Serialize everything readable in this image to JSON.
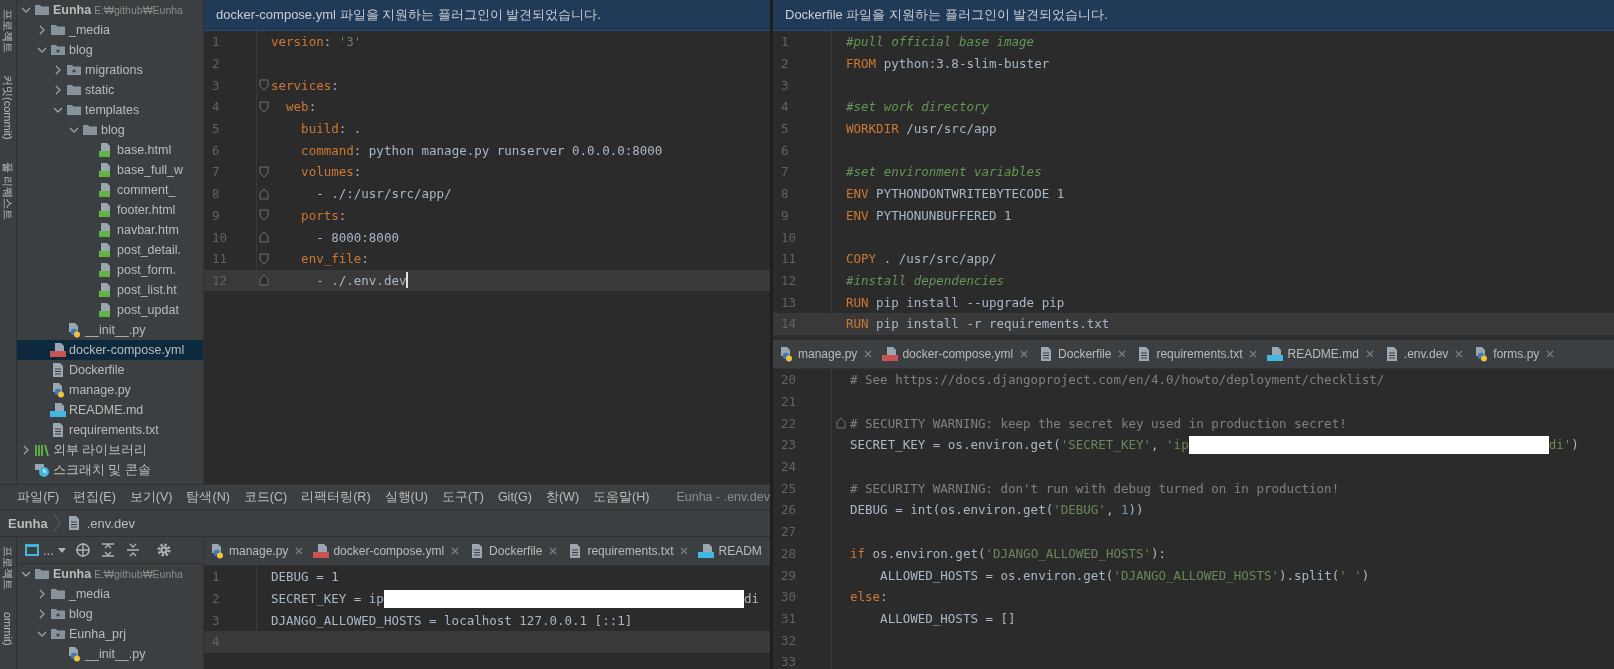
{
  "side_strip_top": {
    "labels": [
      "프로젝트",
      "커밋(commit)",
      "풀 리퀘스트"
    ]
  },
  "project_tree_top": {
    "items": [
      {
        "label": "Eunha",
        "path": "E:₩github₩Eunha",
        "kind": "folder",
        "expanded": true,
        "selected": false,
        "children": [
          {
            "label": "_media",
            "kind": "folder",
            "expanded": false,
            "selected": false
          },
          {
            "label": "blog",
            "kind": "package",
            "expanded": true,
            "selected": false,
            "children": [
              {
                "label": "migrations",
                "kind": "package",
                "expanded": false,
                "selected": false
              },
              {
                "label": "static",
                "kind": "folder",
                "expanded": false,
                "selected": false
              },
              {
                "label": "templates",
                "kind": "folder",
                "expanded": true,
                "selected": false,
                "children": [
                  {
                    "label": "blog",
                    "kind": "folder",
                    "expanded": true,
                    "selected": false,
                    "children": [
                      {
                        "label": "base.html",
                        "kind": "html",
                        "selected": false
                      },
                      {
                        "label": "base_full_w",
                        "kind": "html",
                        "selected": false
                      },
                      {
                        "label": "comment_",
                        "kind": "html",
                        "selected": false
                      },
                      {
                        "label": "footer.html",
                        "kind": "html",
                        "selected": false
                      },
                      {
                        "label": "navbar.htm",
                        "kind": "html",
                        "selected": false
                      },
                      {
                        "label": "post_detail.",
                        "kind": "html",
                        "selected": false
                      },
                      {
                        "label": "post_form.",
                        "kind": "html",
                        "selected": false
                      },
                      {
                        "label": "post_list.ht",
                        "kind": "html",
                        "selected": false
                      },
                      {
                        "label": "post_updat",
                        "kind": "html",
                        "selected": false
                      }
                    ]
                  }
                ]
              },
              {
                "label": "__init__.py",
                "kind": "python",
                "selected": false
              }
            ]
          },
          {
            "label": "docker-compose.yml",
            "kind": "yml",
            "selected": true
          },
          {
            "label": "Dockerfile",
            "kind": "file",
            "selected": false
          },
          {
            "label": "manage.py",
            "kind": "python",
            "selected": false
          },
          {
            "label": "README.md",
            "kind": "md",
            "selected": false
          },
          {
            "label": "requirements.txt",
            "kind": "file",
            "selected": false
          }
        ]
      },
      {
        "label": "외부 라이브러리",
        "kind": "library",
        "expanded": false,
        "selected": false
      },
      {
        "label": "스크래치 및 콘솔",
        "kind": "scratch",
        "selected": false
      }
    ]
  },
  "editor_top_left": {
    "notice": "docker-compose.yml 파일을 지원하는 플러그인이 발견되었습니다.",
    "lines": [
      {
        "num": "1",
        "current": false,
        "tokens": [
          {
            "kind": "key",
            "text": "version"
          },
          {
            "kind": "plain",
            "text": ": "
          },
          {
            "kind": "string",
            "text": "'3'"
          }
        ]
      },
      {
        "num": "2",
        "current": false
      },
      {
        "num": "3",
        "current": false,
        "kind": "fold-start",
        "tokens": [
          {
            "kind": "key",
            "text": "services"
          },
          {
            "kind": "plain",
            "text": ":"
          }
        ]
      },
      {
        "num": "4",
        "current": false,
        "kind": "fold-start",
        "tokens": [
          {
            "kind": "key",
            "text": "  web"
          },
          {
            "kind": "plain",
            "text": ":"
          }
        ]
      },
      {
        "num": "5",
        "current": false,
        "tokens": [
          {
            "kind": "key",
            "text": "    build"
          },
          {
            "kind": "plain",
            "text": ": ."
          }
        ]
      },
      {
        "num": "6",
        "current": false,
        "tokens": [
          {
            "kind": "key",
            "text": "    command"
          },
          {
            "kind": "plain",
            "text": ": python manage.py runserver 0.0.0.0:8000"
          }
        ]
      },
      {
        "num": "7",
        "current": false,
        "kind": "fold-start",
        "tokens": [
          {
            "kind": "key",
            "text": "    volumes"
          },
          {
            "kind": "plain",
            "text": ":"
          }
        ]
      },
      {
        "num": "8",
        "current": false,
        "kind": "fold-end",
        "tokens": [
          {
            "kind": "plain",
            "text": "      - ./:/usr/src/app/"
          }
        ]
      },
      {
        "num": "9",
        "current": false,
        "kind": "fold-start",
        "tokens": [
          {
            "kind": "key",
            "text": "    ports"
          },
          {
            "kind": "plain",
            "text": ":"
          }
        ]
      },
      {
        "num": "10",
        "current": false,
        "kind": "fold-end",
        "tokens": [
          {
            "kind": "plain",
            "text": "      - 8000:8000"
          }
        ]
      },
      {
        "num": "11",
        "current": false,
        "kind": "fold-start",
        "tokens": [
          {
            "kind": "key",
            "text": "    env_file"
          },
          {
            "kind": "plain",
            "text": ":"
          }
        ]
      },
      {
        "num": "12",
        "current": true,
        "kind": "fold-end",
        "tokens": [
          {
            "kind": "plain",
            "text": "      - ./.env.dev"
          }
        ]
      }
    ]
  },
  "menu_bar": {
    "items": [
      "파일(F)",
      "편집(E)",
      "보기(V)",
      "탐색(N)",
      "코드(C)",
      "리팩터링(R)",
      "실행(U)",
      "도구(T)",
      "Git(G)",
      "창(W)",
      "도움말(H)"
    ],
    "title": "Eunha - .env.dev"
  },
  "breadcrumb": {
    "project": "Eunha",
    "file": ".env.dev"
  },
  "side_strip_bottom": {
    "labels": [
      "프로젝트",
      "ommit)"
    ]
  },
  "tree_toolbar": {
    "view_label": "..."
  },
  "project_tree_bottom": {
    "items": [
      {
        "label": "Eunha",
        "path": "E:₩github₩Eunha",
        "kind": "folder",
        "expanded": true,
        "selected": false,
        "children": [
          {
            "label": "_media",
            "kind": "folder",
            "expanded": false,
            "selected": false
          },
          {
            "label": "blog",
            "kind": "package",
            "expanded": false,
            "selected": false
          },
          {
            "label": "Eunha_prj",
            "kind": "package",
            "expanded": true,
            "selected": false,
            "children": [
              {
                "label": "__init__.py",
                "kind": "python",
                "selected": false
              }
            ]
          }
        ]
      }
    ]
  },
  "editor_bottom_left": {
    "tabs": [
      {
        "label": "manage.py",
        "kind": "python",
        "selected": false,
        "closable": true
      },
      {
        "label": "docker-compose.yml",
        "kind": "yml",
        "selected": false,
        "closable": true
      },
      {
        "label": "Dockerfile",
        "kind": "file",
        "selected": false,
        "closable": true
      },
      {
        "label": "requirements.txt",
        "kind": "file",
        "selected": false,
        "closable": true
      },
      {
        "label": "READM",
        "kind": "md",
        "selected": false,
        "closable": false
      }
    ],
    "lines": [
      {
        "num": "1",
        "current": false,
        "tokens": [
          {
            "kind": "plain",
            "text": "DEBUG = 1"
          }
        ]
      },
      {
        "num": "2",
        "current": false,
        "tokens": [
          {
            "kind": "plain",
            "text": "SECRET_KEY = ip"
          },
          {
            "kind": "redacted"
          },
          {
            "kind": "plain",
            "text": "di"
          }
        ]
      },
      {
        "num": "3",
        "current": false,
        "tokens": [
          {
            "kind": "plain",
            "text": "DJANGO_ALLOWED_HOSTS = localhost 127.0.0.1 [::1]"
          }
        ]
      },
      {
        "num": "4",
        "current": true
      }
    ]
  },
  "editor_top_right": {
    "notice": "Dockerfile 파일을 지원하는 플러그인이 발견되었습니다.",
    "lines": [
      {
        "num": "1",
        "current": false,
        "tokens": [
          {
            "kind": "italic-comment",
            "text": "#pull official base image"
          }
        ]
      },
      {
        "num": "2",
        "current": false,
        "tokens": [
          {
            "kind": "keyword",
            "text": "FROM"
          },
          {
            "kind": "plain",
            "text": " python:3.8-slim-buster"
          }
        ]
      },
      {
        "num": "3",
        "current": false
      },
      {
        "num": "4",
        "current": false,
        "tokens": [
          {
            "kind": "italic-comment",
            "text": "#set work directory"
          }
        ]
      },
      {
        "num": "5",
        "current": false,
        "tokens": [
          {
            "kind": "keyword",
            "text": "WORKDIR"
          },
          {
            "kind": "plain",
            "text": " /usr/src/app"
          }
        ]
      },
      {
        "num": "6",
        "current": false
      },
      {
        "num": "7",
        "current": false,
        "tokens": [
          {
            "kind": "italic-comment",
            "text": "#set environment variables"
          }
        ]
      },
      {
        "num": "8",
        "current": false,
        "tokens": [
          {
            "kind": "keyword",
            "text": "ENV"
          },
          {
            "kind": "plain",
            "text": " PYTHONDONTWRITEBYTECODE 1"
          }
        ]
      },
      {
        "num": "9",
        "current": false,
        "tokens": [
          {
            "kind": "keyword",
            "text": "ENV"
          },
          {
            "kind": "plain",
            "text": " PYTHONUNBUFFERED 1"
          }
        ]
      },
      {
        "num": "10",
        "current": false
      },
      {
        "num": "11",
        "current": false,
        "tokens": [
          {
            "kind": "keyword",
            "text": "COPY"
          },
          {
            "kind": "plain",
            "text": " . /usr/src/app/"
          }
        ]
      },
      {
        "num": "12",
        "current": false,
        "tokens": [
          {
            "kind": "italic-comment",
            "text": "#install dependencies"
          }
        ]
      },
      {
        "num": "13",
        "current": false,
        "tokens": [
          {
            "kind": "keyword",
            "text": "RUN"
          },
          {
            "kind": "plain",
            "text": " pip install --upgrade pip"
          }
        ]
      },
      {
        "num": "14",
        "current": true,
        "tokens": [
          {
            "kind": "keyword",
            "text": "RUN"
          },
          {
            "kind": "plain",
            "text": " pip install -r requirements.txt"
          }
        ]
      }
    ]
  },
  "editor_bottom_right": {
    "tabs": [
      {
        "label": "manage.py",
        "kind": "python",
        "selected": false,
        "closable": true
      },
      {
        "label": "docker-compose.yml",
        "kind": "yml",
        "selected": false,
        "closable": true
      },
      {
        "label": "Dockerfile",
        "kind": "file",
        "selected": false,
        "closable": true
      },
      {
        "label": "requirements.txt",
        "kind": "file",
        "selected": false,
        "closable": true
      },
      {
        "label": "README.md",
        "kind": "md",
        "selected": false,
        "closable": true
      },
      {
        "label": ".env.dev",
        "kind": "file",
        "selected": false,
        "closable": true
      },
      {
        "label": "forms.py",
        "kind": "python",
        "selected": false,
        "closable": true
      }
    ],
    "lines": [
      {
        "num": "20",
        "current": false,
        "tokens": [
          {
            "kind": "comment",
            "text": "# See https://docs.djangoproject.com/en/4.0/howto/deployment/checklist/"
          }
        ]
      },
      {
        "num": "21",
        "current": false
      },
      {
        "num": "22",
        "current": false,
        "kind": "fold-end",
        "tokens": [
          {
            "kind": "comment",
            "text": "# SECURITY WARNING: keep the secret key used in production secret!"
          }
        ]
      },
      {
        "num": "23",
        "current": false,
        "tokens": [
          {
            "kind": "plain",
            "text": "SECRET_KEY = os.environ.get("
          },
          {
            "kind": "string",
            "text": "'SECRET_KEY'"
          },
          {
            "kind": "plain",
            "text": ", "
          },
          {
            "kind": "string",
            "text": "'ip"
          },
          {
            "kind": "redacted"
          },
          {
            "kind": "string",
            "text": "di'"
          },
          {
            "kind": "plain",
            "text": ")"
          }
        ]
      },
      {
        "num": "24",
        "current": false
      },
      {
        "num": "25",
        "current": false,
        "tokens": [
          {
            "kind": "comment",
            "text": "# SECURITY WARNING: don't run with debug turned on in production!"
          }
        ]
      },
      {
        "num": "26",
        "current": false,
        "tokens": [
          {
            "kind": "plain",
            "text": "DEBUG = int(os.environ.get("
          },
          {
            "kind": "string",
            "text": "'DEBUG'"
          },
          {
            "kind": "plain",
            "text": ", "
          },
          {
            "kind": "number",
            "text": "1"
          },
          {
            "kind": "plain",
            "text": "))"
          }
        ]
      },
      {
        "num": "27",
        "current": false
      },
      {
        "num": "28",
        "current": false,
        "tokens": [
          {
            "kind": "keyword",
            "text": "if"
          },
          {
            "kind": "plain",
            "text": " os.environ.get("
          },
          {
            "kind": "string",
            "text": "'DJANGO_ALLOWED_HOSTS'"
          },
          {
            "kind": "plain",
            "text": "):"
          }
        ]
      },
      {
        "num": "29",
        "current": false,
        "tokens": [
          {
            "kind": "plain",
            "text": "    ALLOWED_HOSTS = os.environ.get("
          },
          {
            "kind": "string",
            "text": "'DJANGO_ALLOWED_HOSTS'"
          },
          {
            "kind": "plain",
            "text": ").split("
          },
          {
            "kind": "string",
            "text": "' '"
          },
          {
            "kind": "plain",
            "text": ")"
          }
        ]
      },
      {
        "num": "30",
        "current": false,
        "tokens": [
          {
            "kind": "keyword",
            "text": "else"
          },
          {
            "kind": "plain",
            "text": ":"
          }
        ]
      },
      {
        "num": "31",
        "current": false,
        "tokens": [
          {
            "kind": "plain",
            "text": "    ALLOWED_HOSTS = []"
          }
        ]
      },
      {
        "num": "32",
        "current": false
      },
      {
        "num": "33",
        "current": false
      }
    ]
  }
}
